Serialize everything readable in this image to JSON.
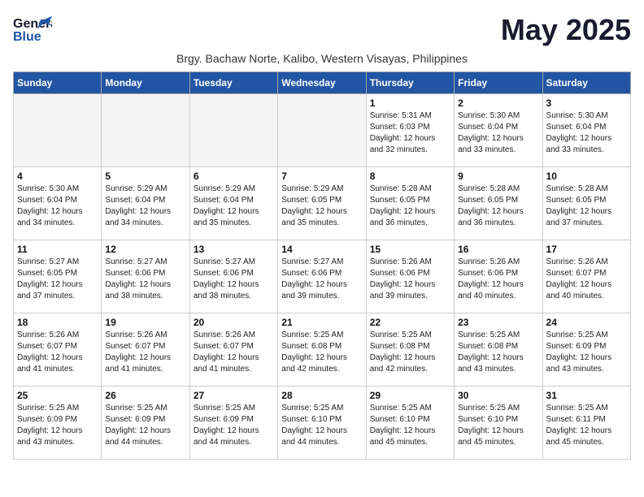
{
  "header": {
    "logo_line1": "General",
    "logo_line2": "Blue",
    "month_title": "May 2025",
    "subtitle": "Brgy. Bachaw Norte, Kalibo, Western Visayas, Philippines"
  },
  "weekdays": [
    "Sunday",
    "Monday",
    "Tuesday",
    "Wednesday",
    "Thursday",
    "Friday",
    "Saturday"
  ],
  "weeks": [
    [
      {
        "day": "",
        "info": ""
      },
      {
        "day": "",
        "info": ""
      },
      {
        "day": "",
        "info": ""
      },
      {
        "day": "",
        "info": ""
      },
      {
        "day": "1",
        "info": "Sunrise: 5:31 AM\nSunset: 6:03 PM\nDaylight: 12 hours\nand 32 minutes."
      },
      {
        "day": "2",
        "info": "Sunrise: 5:30 AM\nSunset: 6:04 PM\nDaylight: 12 hours\nand 33 minutes."
      },
      {
        "day": "3",
        "info": "Sunrise: 5:30 AM\nSunset: 6:04 PM\nDaylight: 12 hours\nand 33 minutes."
      }
    ],
    [
      {
        "day": "4",
        "info": "Sunrise: 5:30 AM\nSunset: 6:04 PM\nDaylight: 12 hours\nand 34 minutes."
      },
      {
        "day": "5",
        "info": "Sunrise: 5:29 AM\nSunset: 6:04 PM\nDaylight: 12 hours\nand 34 minutes."
      },
      {
        "day": "6",
        "info": "Sunrise: 5:29 AM\nSunset: 6:04 PM\nDaylight: 12 hours\nand 35 minutes."
      },
      {
        "day": "7",
        "info": "Sunrise: 5:29 AM\nSunset: 6:05 PM\nDaylight: 12 hours\nand 35 minutes."
      },
      {
        "day": "8",
        "info": "Sunrise: 5:28 AM\nSunset: 6:05 PM\nDaylight: 12 hours\nand 36 minutes."
      },
      {
        "day": "9",
        "info": "Sunrise: 5:28 AM\nSunset: 6:05 PM\nDaylight: 12 hours\nand 36 minutes."
      },
      {
        "day": "10",
        "info": "Sunrise: 5:28 AM\nSunset: 6:05 PM\nDaylight: 12 hours\nand 37 minutes."
      }
    ],
    [
      {
        "day": "11",
        "info": "Sunrise: 5:27 AM\nSunset: 6:05 PM\nDaylight: 12 hours\nand 37 minutes."
      },
      {
        "day": "12",
        "info": "Sunrise: 5:27 AM\nSunset: 6:06 PM\nDaylight: 12 hours\nand 38 minutes."
      },
      {
        "day": "13",
        "info": "Sunrise: 5:27 AM\nSunset: 6:06 PM\nDaylight: 12 hours\nand 38 minutes."
      },
      {
        "day": "14",
        "info": "Sunrise: 5:27 AM\nSunset: 6:06 PM\nDaylight: 12 hours\nand 39 minutes."
      },
      {
        "day": "15",
        "info": "Sunrise: 5:26 AM\nSunset: 6:06 PM\nDaylight: 12 hours\nand 39 minutes."
      },
      {
        "day": "16",
        "info": "Sunrise: 5:26 AM\nSunset: 6:06 PM\nDaylight: 12 hours\nand 40 minutes."
      },
      {
        "day": "17",
        "info": "Sunrise: 5:26 AM\nSunset: 6:07 PM\nDaylight: 12 hours\nand 40 minutes."
      }
    ],
    [
      {
        "day": "18",
        "info": "Sunrise: 5:26 AM\nSunset: 6:07 PM\nDaylight: 12 hours\nand 41 minutes."
      },
      {
        "day": "19",
        "info": "Sunrise: 5:26 AM\nSunset: 6:07 PM\nDaylight: 12 hours\nand 41 minutes."
      },
      {
        "day": "20",
        "info": "Sunrise: 5:26 AM\nSunset: 6:07 PM\nDaylight: 12 hours\nand 41 minutes."
      },
      {
        "day": "21",
        "info": "Sunrise: 5:25 AM\nSunset: 6:08 PM\nDaylight: 12 hours\nand 42 minutes."
      },
      {
        "day": "22",
        "info": "Sunrise: 5:25 AM\nSunset: 6:08 PM\nDaylight: 12 hours\nand 42 minutes."
      },
      {
        "day": "23",
        "info": "Sunrise: 5:25 AM\nSunset: 6:08 PM\nDaylight: 12 hours\nand 43 minutes."
      },
      {
        "day": "24",
        "info": "Sunrise: 5:25 AM\nSunset: 6:09 PM\nDaylight: 12 hours\nand 43 minutes."
      }
    ],
    [
      {
        "day": "25",
        "info": "Sunrise: 5:25 AM\nSunset: 6:09 PM\nDaylight: 12 hours\nand 43 minutes."
      },
      {
        "day": "26",
        "info": "Sunrise: 5:25 AM\nSunset: 6:09 PM\nDaylight: 12 hours\nand 44 minutes."
      },
      {
        "day": "27",
        "info": "Sunrise: 5:25 AM\nSunset: 6:09 PM\nDaylight: 12 hours\nand 44 minutes."
      },
      {
        "day": "28",
        "info": "Sunrise: 5:25 AM\nSunset: 6:10 PM\nDaylight: 12 hours\nand 44 minutes."
      },
      {
        "day": "29",
        "info": "Sunrise: 5:25 AM\nSunset: 6:10 PM\nDaylight: 12 hours\nand 45 minutes."
      },
      {
        "day": "30",
        "info": "Sunrise: 5:25 AM\nSunset: 6:10 PM\nDaylight: 12 hours\nand 45 minutes."
      },
      {
        "day": "31",
        "info": "Sunrise: 5:25 AM\nSunset: 6:11 PM\nDaylight: 12 hours\nand 45 minutes."
      }
    ]
  ]
}
